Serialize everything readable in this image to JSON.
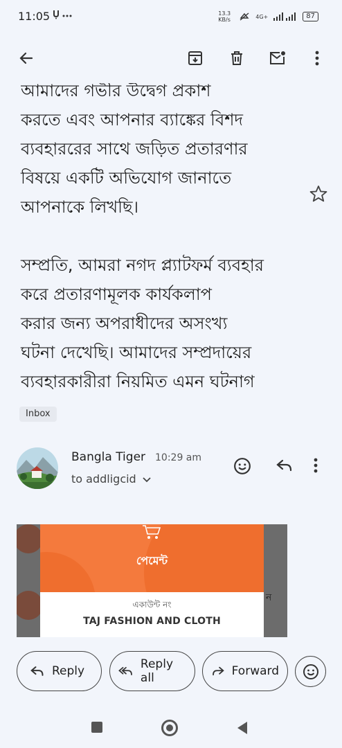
{
  "status": {
    "time": "11:05",
    "left_icons": "ٔ ···",
    "net_speed": "13.3 KB/s",
    "network": "4G+",
    "battery": "87"
  },
  "toolbar": {
    "back_icon": "arrow-left",
    "archive_icon": "archive-box",
    "delete_icon": "trash",
    "mail_icon": "mark-unread",
    "more_icon": "more-vertical"
  },
  "message": {
    "paragraphs": [
      {
        "lines": [
          "আমাদের গভীর উদ্বেগ প্রকাশ",
          "করতে এবং আপনার ব্যাঙ্কের বিশদ",
          "ব্যবহাররের সাথে জড়িত প্রতারণার",
          "বিষয়ে একটি অভিযোগ জানাতে",
          "আপনাকে লিখছি।"
        ]
      },
      {
        "lines": [
          "সম্প্রতি, আমরা নগদ প্ল্যাটফর্ম ব্যবহার",
          "করে প্রতারণামূলক কার্যকলাপ",
          "করার জন্য অপরাধীদের অসংখ্য",
          "ঘটনা দেখেছি। আমাদের সম্প্রদায়ের",
          "ব্যবহারকারীরা নিয়মিত এমন ঘটনাগ"
        ]
      }
    ],
    "label": "Inbox"
  },
  "sender": {
    "name": "Bangla Tiger",
    "time": "10:29 am",
    "recipient": "to addligcid"
  },
  "preview": {
    "title": "পেমেন্ট",
    "account_label": "একাউন্ট নং",
    "account_name": "TAJ FASHION AND CLOTH",
    "side_text": "ন"
  },
  "actions": {
    "reply": "Reply",
    "reply_all": "Reply all",
    "forward": "Forward"
  },
  "colors": {
    "background": "#f2f5fb",
    "preview_orange": "#f47a3d"
  }
}
